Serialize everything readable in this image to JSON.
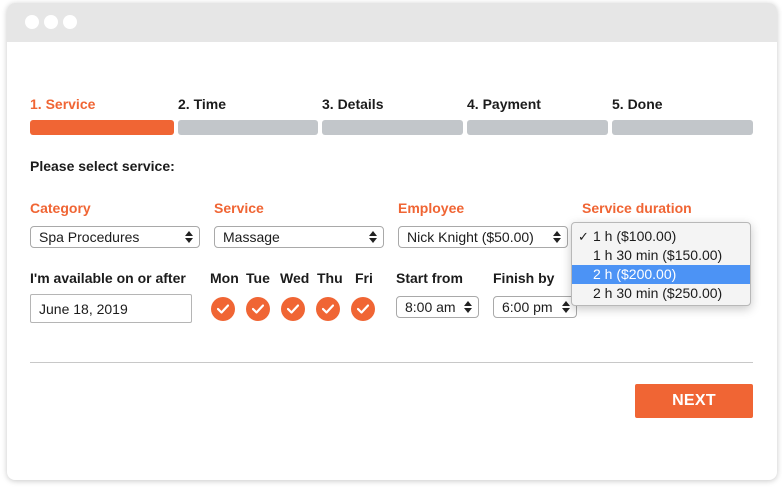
{
  "steps": [
    {
      "label": "1. Service",
      "active": true
    },
    {
      "label": "2. Time",
      "active": false
    },
    {
      "label": "3. Details",
      "active": false
    },
    {
      "label": "4. Payment",
      "active": false
    },
    {
      "label": "5. Done",
      "active": false
    }
  ],
  "section_title": "Please select service:",
  "fields": {
    "category": {
      "label": "Category",
      "value": "Spa Procedures"
    },
    "service": {
      "label": "Service",
      "value": "Massage"
    },
    "employee": {
      "label": "Employee",
      "value": "Nick Knight ($50.00)"
    },
    "duration": {
      "label": "Service duration",
      "options": [
        "1 h ($100.00)",
        "1 h 30 min ($150.00)",
        "2 h ($200.00)",
        "2 h 30 min ($250.00)"
      ],
      "checked_option": "1 h ($100.00)",
      "highlighted_option": "2 h ($200.00)"
    }
  },
  "availability": {
    "label": "I'm available on or after",
    "date": "June 18, 2019",
    "days": [
      "Mon",
      "Tue",
      "Wed",
      "Thu",
      "Fri"
    ],
    "start_label": "Start from",
    "start_value": "8:00 am",
    "finish_label": "Finish by",
    "finish_value": "6:00 pm"
  },
  "next_label": "NEXT",
  "colors": {
    "accent": "#f06534",
    "bar_inactive": "#c2c6ca",
    "highlight": "#4c93f5"
  }
}
